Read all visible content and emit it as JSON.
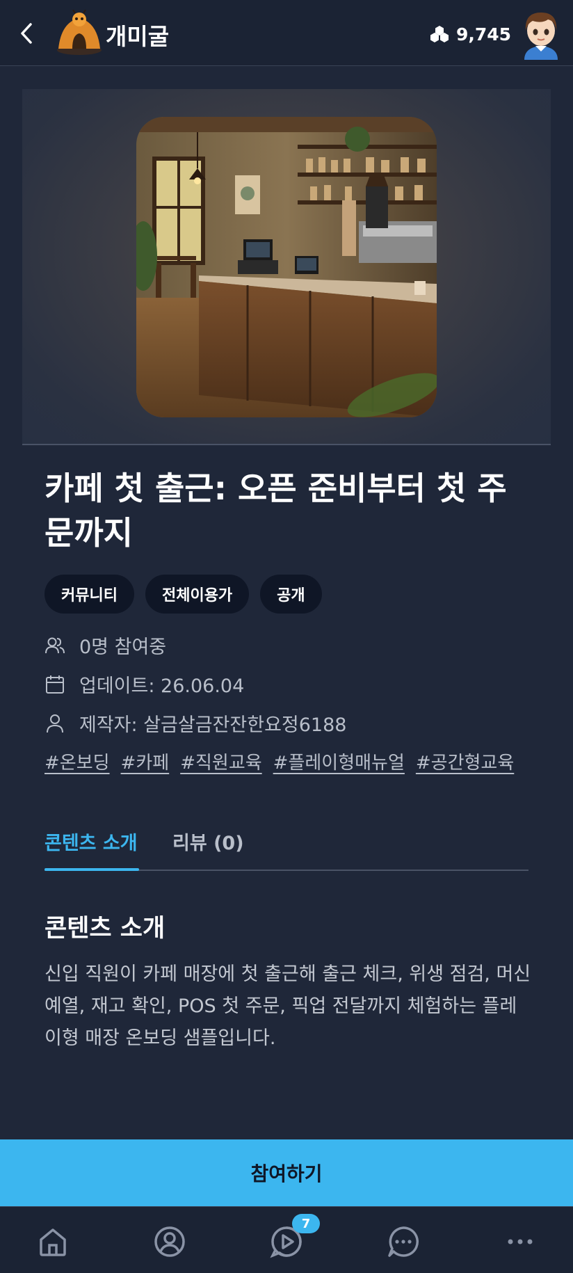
{
  "header": {
    "app_title": "개미굴",
    "coins": "9,745"
  },
  "content": {
    "title": "카페 첫 출근: 오픈 준비부터 첫 주문까지",
    "chips": [
      "커뮤니티",
      "전체이용가",
      "공개"
    ],
    "participants": "0명 참여중",
    "updated": "업데이트: 26.06.04",
    "creator": "제작자: 살금살금잔잔한요정6188",
    "tags": [
      "#온보딩",
      "#카페",
      "#직원교육",
      "#플레이형매뉴얼",
      "#공간형교육"
    ]
  },
  "tabs": {
    "intro": "콘텐츠 소개",
    "review": "리뷰 (0)"
  },
  "intro_section": {
    "heading": "콘텐츠 소개",
    "body": "신입 직원이 카페 매장에 첫 출근해 출근 체크, 위생 점검, 머신 예열, 재고 확인, POS 첫 주문, 픽업 전달까지 체험하는 플레이형 매장 온보딩 샘플입니다."
  },
  "join_button": "참여하기",
  "bottom_nav": {
    "badge": "7",
    "items": [
      "home-icon",
      "profile-icon",
      "play-icon",
      "chat-icon",
      "more-icon"
    ]
  },
  "colors": {
    "background": "#1f2739",
    "accent": "#3cb6ef",
    "chip": "#0f1626"
  }
}
